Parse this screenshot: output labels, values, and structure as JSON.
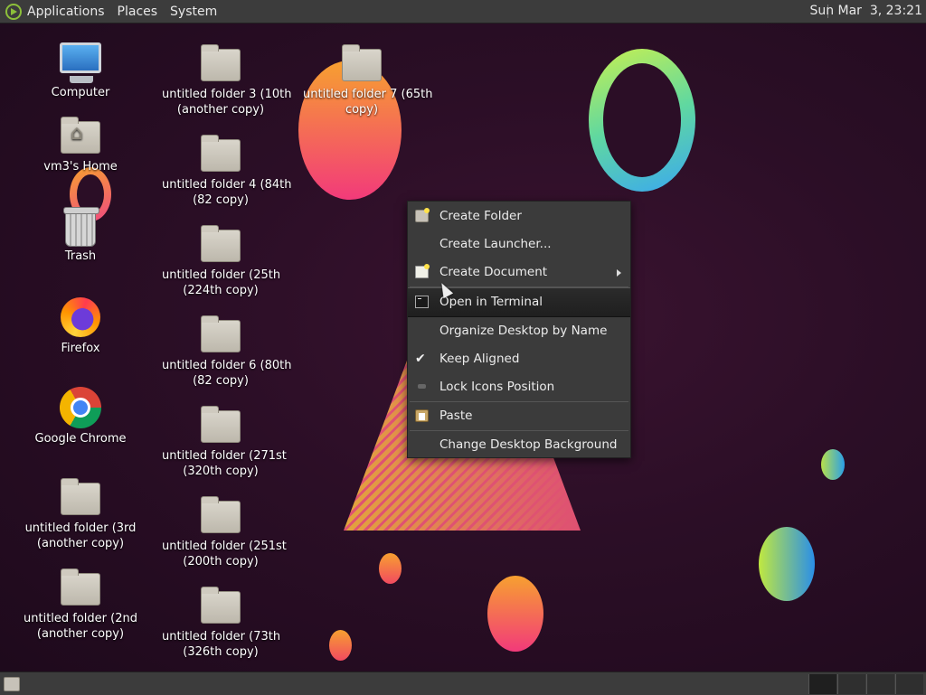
{
  "top_panel": {
    "menus": [
      "Applications",
      "Places",
      "System"
    ],
    "clock": "Sun Mar  3, 23:21"
  },
  "desktop": {
    "left_column": [
      {
        "label": "Computer",
        "icon": "computer-icon"
      },
      {
        "label": "vm3's Home",
        "icon": "home-folder-icon"
      },
      {
        "label": "Trash",
        "icon": "trash-icon"
      },
      {
        "label": "Firefox",
        "icon": "firefox-icon"
      },
      {
        "label": "Google Chrome",
        "icon": "chrome-icon"
      },
      {
        "label": "untitled folder (3rd\n(another copy)",
        "icon": "folder-icon"
      },
      {
        "label": "untitled folder (2nd\n(another copy)",
        "icon": "folder-icon"
      }
    ],
    "middle_column": [
      {
        "label": "untitled folder 3 (10th\n(another copy)",
        "icon": "folder-icon"
      },
      {
        "label": "untitled folder 4 (84th\n(82 copy)",
        "icon": "folder-icon"
      },
      {
        "label": "untitled folder (25th\n(224th copy)",
        "icon": "folder-icon"
      },
      {
        "label": "untitled folder 6 (80th\n(82 copy)",
        "icon": "folder-icon"
      },
      {
        "label": "untitled folder (271st\n(320th copy)",
        "icon": "folder-icon"
      },
      {
        "label": "untitled folder (251st\n(200th copy)",
        "icon": "folder-icon"
      },
      {
        "label": "untitled folder (73th\n(326th copy)",
        "icon": "folder-icon"
      }
    ],
    "right_column": [
      {
        "label": "untitled folder 7 (65th\ncopy)",
        "icon": "folder-icon"
      }
    ]
  },
  "context_menu": {
    "items": [
      {
        "label": "Create Folder",
        "icon": "create-folder-icon"
      },
      {
        "label": "Create Launcher...",
        "icon": ""
      },
      {
        "label": "Create Document",
        "icon": "create-document-icon",
        "submenu": true
      },
      {
        "label": "Open in Terminal",
        "icon": "terminal-icon",
        "highlighted": true
      },
      {
        "label": "Organize Desktop by Name",
        "icon": ""
      },
      {
        "label": "Keep Aligned",
        "icon": "checkmark-icon",
        "checked": true
      },
      {
        "label": "Lock Icons Position",
        "icon": "lock-icon"
      },
      {
        "label": "Paste",
        "icon": "paste-icon"
      },
      {
        "label": "Change Desktop Background",
        "icon": ""
      }
    ]
  },
  "colors": {
    "panel_bg": "#3c3c3c",
    "menu_bg": "#3b3b3b",
    "highlight_bg": "#1f1f1f",
    "wallpaper_bg": "#2b0e26"
  }
}
